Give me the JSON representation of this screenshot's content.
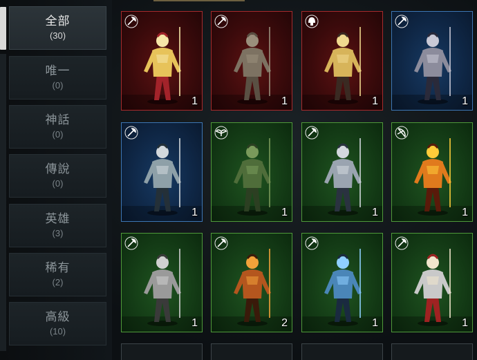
{
  "sidebar": {
    "categories": [
      {
        "id": "all",
        "name": "全部",
        "count": "(30)",
        "active": true
      },
      {
        "id": "unique",
        "name": "唯一",
        "count": "(0)",
        "active": false
      },
      {
        "id": "mythic",
        "name": "神話",
        "count": "(0)",
        "active": false
      },
      {
        "id": "legendary",
        "name": "傳說",
        "count": "(0)",
        "active": false
      },
      {
        "id": "heroic",
        "name": "英雄",
        "count": "(3)",
        "active": false
      },
      {
        "id": "rare",
        "name": "稀有",
        "count": "(2)",
        "active": false
      },
      {
        "id": "advanced",
        "name": "高級",
        "count": "(10)",
        "active": false
      }
    ]
  },
  "grid": {
    "cards": [
      {
        "rarity": "red",
        "class_icon": "axe-icon",
        "figure": "golden-paladin-figure",
        "level": "1"
      },
      {
        "rarity": "red",
        "class_icon": "axe-icon",
        "figure": "centaur-figure",
        "level": "1"
      },
      {
        "rarity": "red",
        "class_icon": "helmet-icon",
        "figure": "winged-warrior-figure",
        "level": "1"
      },
      {
        "rarity": "blue",
        "class_icon": "axe-icon",
        "figure": "spear-warrior-figure",
        "level": "1"
      },
      {
        "rarity": "blue",
        "class_icon": "axe-icon",
        "figure": "halberd-warrior-figure",
        "level": "1"
      },
      {
        "rarity": "green",
        "class_icon": "wings-icon",
        "figure": "lizard-soldier-figure",
        "level": "1"
      },
      {
        "rarity": "green",
        "class_icon": "axe-icon",
        "figure": "horned-knight-figure",
        "level": "1"
      },
      {
        "rarity": "green",
        "class_icon": "bow-icon",
        "figure": "fire-archer-figure",
        "level": "1"
      },
      {
        "rarity": "green",
        "class_icon": "axe-icon",
        "figure": "dwarf-miner-figure",
        "level": "1"
      },
      {
        "rarity": "green",
        "class_icon": "axe-icon",
        "figure": "antlered-beast-figure",
        "level": "2"
      },
      {
        "rarity": "green",
        "class_icon": "axe-icon",
        "figure": "blue-dragon-beast-figure",
        "level": "1"
      },
      {
        "rarity": "green",
        "class_icon": "axe-icon",
        "figure": "cat-knight-figure",
        "level": "1"
      }
    ]
  },
  "colors": {
    "red_border": "#a72a2c",
    "blue_border": "#3d77b5",
    "green_border": "#4f9a3a",
    "active_text": "#e8e8e8",
    "inactive_text": "#8d969b"
  }
}
